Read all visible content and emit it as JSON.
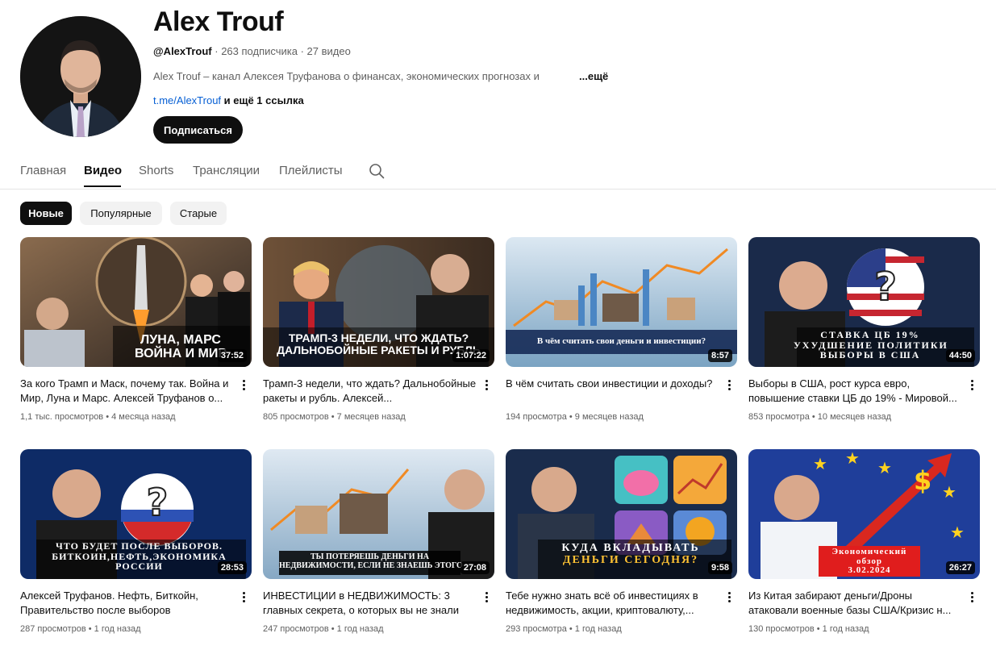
{
  "channel": {
    "title": "Alex Trouf",
    "handle": "@AlexTrouf",
    "stats": " · 263 подписчика · 27 видео",
    "description": "Alex Trouf –  канал Алексея Труфанова о финансах, экономических прогнозах и",
    "more": "...ещё",
    "link": "t.me/AlexTrouf",
    "link_extra": " и ещё 1 ссылка",
    "subscribe_label": "Подписаться"
  },
  "tabs": [
    "Главная",
    "Видео",
    "Shorts",
    "Трансляции",
    "Плейлисты"
  ],
  "active_tab": "Видео",
  "chips": [
    "Новые",
    "Популярные",
    "Старые"
  ],
  "active_chip": "Новые",
  "videos": [
    {
      "title": "За кого Трамп и Маск, почему так. Война и Мир, Луна и Марс. Алексей Труфанов о...",
      "views": "1,1 тыс. просмотров",
      "age": "4 месяца назад",
      "duration": "37:52",
      "overlay": [
        "ЛУНА, МАРС",
        "ВОЙНА И МИР"
      ]
    },
    {
      "title": "Трамп-3 недели, что ждать? Дальнобойные ракеты и рубль. Алексей...",
      "views": "805 просмотров",
      "age": "7 месяцев назад",
      "duration": "1:07:22",
      "overlay": [
        "ТРАМП-3 НЕДЕЛИ, ЧТО ЖДАТЬ?",
        "ДАЛЬНОБОЙНЫЕ РАКЕТЫ И РУБЛЬ"
      ]
    },
    {
      "title": "В чём считать свои инвестиции и доходы?",
      "views": "194 просмотра",
      "age": "9 месяцев назад",
      "duration": "8:57",
      "overlay": [
        "В чём считать свои деньги и инвестиции?"
      ]
    },
    {
      "title": "Выборы в США, рост курса евро, повышение ставки ЦБ до 19% - Мировой...",
      "views": "853 просмотра",
      "age": "10 месяцев назад",
      "duration": "44:50",
      "overlay": [
        "СТАВКА ЦБ 19%",
        "УХУДШЕНИЕ ПОЛИТИКИ",
        "ВЫБОРЫ В США"
      ]
    },
    {
      "title": "Алексей Труфанов. Нефть, Биткойн, Правительство после выборов",
      "views": "287 просмотров",
      "age": "1 год назад",
      "duration": "28:53",
      "overlay": [
        "ЧТО БУДЕТ ПОСЛЕ ВЫБОРОВ.",
        "БИТКОИН,НЕФТЬ,ЭКОНОМИКА",
        "РОССИИ"
      ]
    },
    {
      "title": "ИНВЕСТИЦИИ в НЕДВИЖИМОСТЬ: 3 главных секрета, о которых вы не знали",
      "views": "247 просмотров",
      "age": "1 год назад",
      "duration": "27:08",
      "overlay": [
        "ТЫ ПОТЕРЯЕШЬ ДЕНЬГИ НА",
        "НЕДВИЖИМОСТИ, ЕСЛИ НЕ ЗНАЕШЬ ЭТОГО"
      ]
    },
    {
      "title": "Тебе нужно знать всё об инвестициях в недвижимость, акции, криптовалюту,...",
      "views": "293 просмотра",
      "age": "1 год назад",
      "duration": "9:58",
      "overlay": [
        "КУДА ВКЛАДЫВАТЬ",
        "ДЕНЬГИ СЕГОДНЯ?"
      ]
    },
    {
      "title": "Из Китая забирают деньги/Дроны атаковали военные базы США/Кризис н...",
      "views": "130 просмотров",
      "age": "1 год назад",
      "duration": "26:27",
      "overlay": [
        "Экономический",
        "обзор",
        "3.02.2024"
      ]
    }
  ],
  "colors": {
    "accent": "#0f0f0f",
    "link": "#065fd4",
    "meta": "#606060"
  }
}
